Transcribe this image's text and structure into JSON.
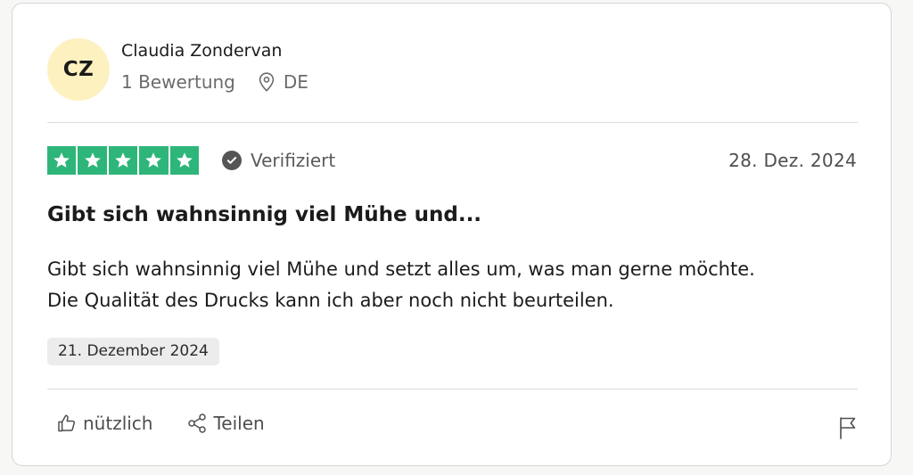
{
  "reviewer": {
    "initials": "CZ",
    "name": "Claudia Zondervan",
    "review_count": "1 Bewertung",
    "country": "DE"
  },
  "review": {
    "rating": 5,
    "verified_label": "Verifiziert",
    "date": "28. Dez. 2024",
    "title": "Gibt sich wahnsinnig viel Mühe und...",
    "body_line1": "Gibt sich wahnsinnig viel Mühe und setzt alles um, was man gerne möchte.",
    "body_line2": "Die Qualität des Drucks kann ich aber noch nicht beurteilen.",
    "experience_date": "21. Dezember 2024"
  },
  "actions": {
    "useful_label": "nützlich",
    "share_label": "Teilen"
  },
  "icons": {
    "location": "location-pin-icon",
    "verified": "check-circle-icon",
    "useful": "thumbs-up-icon",
    "share": "share-icon",
    "report": "flag-icon",
    "star": "star-icon"
  },
  "colors": {
    "star_green": "#2eb67a",
    "avatar_bg": "#fdf1c0",
    "tag_bg": "#ececec"
  }
}
